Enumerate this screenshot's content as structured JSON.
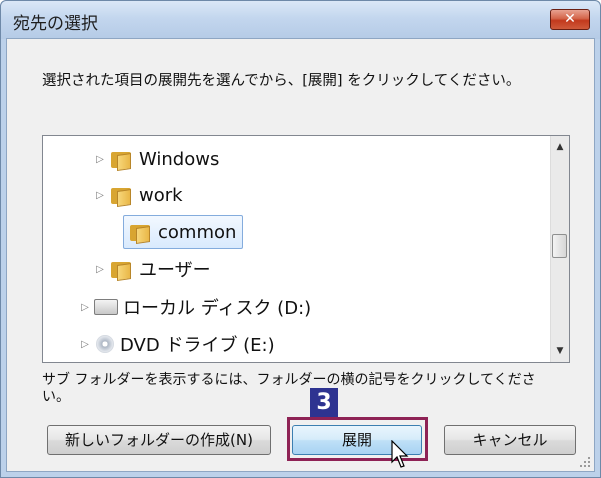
{
  "dialog": {
    "title": "宛先の選択",
    "close_label": "✕",
    "instruction": "選択された項目の展開先を選んでから、[展開] をクリックしてください。",
    "hint": "サブ フォルダーを表示するには、フォルダーの横の記号をクリックしてください。",
    "step_badge": "3"
  },
  "tree": {
    "items": [
      {
        "label": "Windows",
        "expander": "▷",
        "icon": "folder-icon"
      },
      {
        "label": "work",
        "expander": "▷",
        "icon": "folder-icon"
      },
      {
        "label": "common",
        "expander": "",
        "icon": "folder-icon",
        "selected": true
      },
      {
        "label": "ユーザー",
        "expander": "▷",
        "icon": "folder-icon"
      },
      {
        "label": "ローカル ディスク (D:)",
        "expander": "▷",
        "icon": "drive-icon"
      },
      {
        "label": "DVD ドライブ (E:)",
        "expander": "▷",
        "icon": "dvd-icon"
      }
    ]
  },
  "scrollbar": {
    "up": "▲",
    "down": "▼"
  },
  "buttons": {
    "new_folder": "新しいフォルダーの作成(N)",
    "expand": "展開",
    "cancel": "キャンセル"
  },
  "colors": {
    "accent_frame": "#8e2255",
    "step_badge_bg": "#2e3391",
    "close_button": "#c2391d",
    "selection": "#84acdd"
  }
}
